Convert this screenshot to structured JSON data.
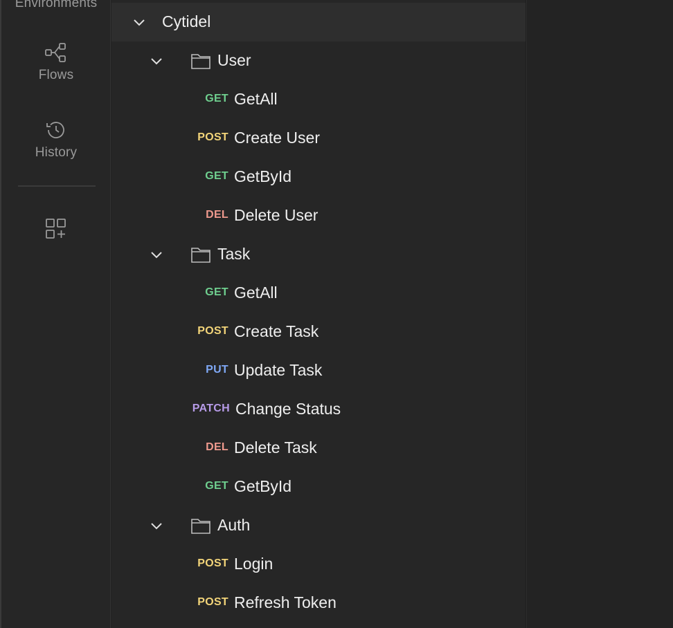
{
  "sidebar": {
    "environments_label": "Environments",
    "flows_label": "Flows",
    "history_label": "History"
  },
  "collection": {
    "name": "Cytidel",
    "folders": [
      {
        "name": "User",
        "requests": [
          {
            "method": "GET",
            "name": "GetAll"
          },
          {
            "method": "POST",
            "name": "Create User"
          },
          {
            "method": "GET",
            "name": "GetById"
          },
          {
            "method": "DEL",
            "name": "Delete User"
          }
        ]
      },
      {
        "name": "Task",
        "requests": [
          {
            "method": "GET",
            "name": "GetAll"
          },
          {
            "method": "POST",
            "name": "Create Task"
          },
          {
            "method": "PUT",
            "name": "Update Task"
          },
          {
            "method": "PATCH",
            "name": "Change Status"
          },
          {
            "method": "DEL",
            "name": "Delete Task"
          },
          {
            "method": "GET",
            "name": "GetById"
          }
        ]
      },
      {
        "name": "Auth",
        "requests": [
          {
            "method": "POST",
            "name": "Login"
          },
          {
            "method": "POST",
            "name": "Refresh Token"
          }
        ]
      }
    ]
  },
  "colors": {
    "GET": "#6fcf8f",
    "POST": "#f2d479",
    "DEL": "#ef9a8e",
    "PUT": "#7fa8f5",
    "PATCH": "#b79be8"
  },
  "icons": {
    "flows": "flows-icon",
    "history": "history-icon",
    "add_workspace": "add-widget-icon",
    "folder": "folder-icon",
    "chevron": "chevron-down-icon"
  }
}
